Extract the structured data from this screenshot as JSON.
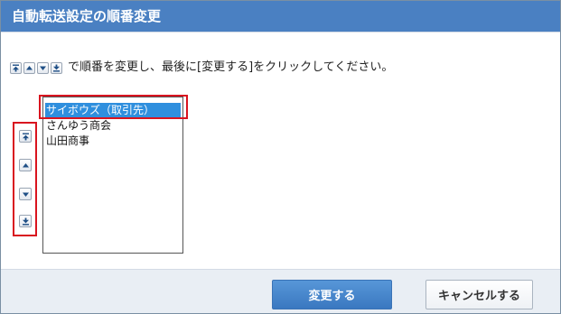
{
  "dialog": {
    "title": "自動転送設定の順番変更"
  },
  "instruction": {
    "text": "で順番を変更し、最後に[変更する]をクリックしてください。",
    "icons": [
      "move-to-top-icon",
      "move-up-icon",
      "move-down-icon",
      "move-to-bottom-icon"
    ]
  },
  "list": {
    "items": [
      {
        "label": "サイボウズ（取引先）",
        "selected": true
      },
      {
        "label": "さんゆう商会",
        "selected": false
      },
      {
        "label": "山田商事",
        "selected": false
      }
    ]
  },
  "footer": {
    "submit_label": "変更する",
    "cancel_label": "キャンセルする"
  },
  "colors": {
    "title_bar": "#4a80c2",
    "selection": "#2f8fde",
    "highlight_border": "#d9141f",
    "primary_button": "#3a78c0",
    "footer_bg": "#e9eef4"
  }
}
